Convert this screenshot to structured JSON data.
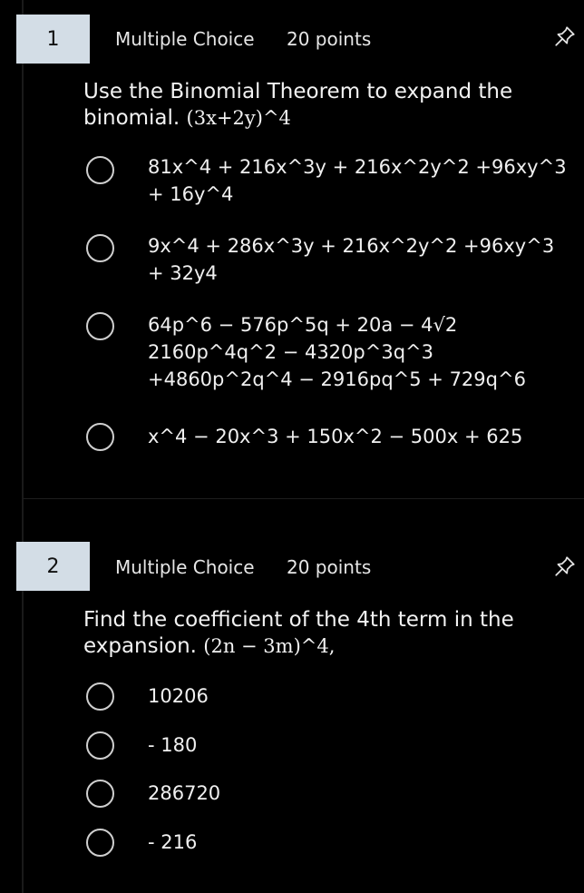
{
  "questions": [
    {
      "number": "1",
      "type": "Multiple Choice",
      "points": "20 points",
      "prompt": "Use the Binomial Theorem to expand the binomial. ",
      "expression": "(3x+2y)^4",
      "options": [
        "81x^4 + 216x^3y + 216x^2y^2 +96xy^3\n+ 16y^4",
        "9x^4 + 286x^3y + 216x^2y^2 +96xy^3\n+ 32y4",
        "64p^6 − 576p^5q + 20a − 4√2\n2160p^4q^2 − 4320p^3q^3\n+4860p^2q^4 − 2916pq^5 + 729q^6",
        "x^4 − 20x^3 + 150x^2 − 500x + 625"
      ]
    },
    {
      "number": "2",
      "type": "Multiple Choice",
      "points": "20 points",
      "prompt": "Find the coefficient of the 4th term in the expansion. ",
      "expression": "(2n − 3m)^4,",
      "options": [
        "10206",
        "- 180",
        "286720",
        "- 216"
      ]
    }
  ],
  "icons": {
    "pin": "pin-icon"
  },
  "colors": {
    "background": "#000000",
    "number_box": "#d3dde6",
    "text": "#ffffff",
    "radio_border": "#cfcfcf"
  }
}
